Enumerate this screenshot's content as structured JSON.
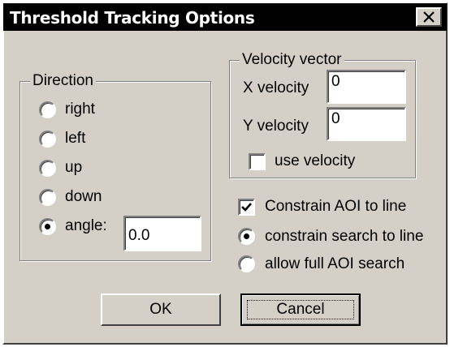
{
  "window": {
    "title": "Threshold Tracking Options",
    "close_glyph": "✕"
  },
  "direction": {
    "legend": "Direction",
    "options": [
      "right",
      "left",
      "up",
      "down",
      "angle:"
    ],
    "selected": "angle:",
    "angle_value": "0.0"
  },
  "velocity": {
    "legend": "Velocity vector",
    "x_label": "X velocity",
    "x_value": "0",
    "y_label": "Y velocity",
    "y_value": "0",
    "use_label": "use velocity",
    "use_checked": false
  },
  "constrain": {
    "checkbox_label": "Constrain AOI to line",
    "checkbox_checked": true,
    "options": [
      "constrain search to line",
      "allow full AOI search"
    ],
    "selected": "constrain search to line"
  },
  "buttons": {
    "ok": "OK",
    "cancel": "Cancel"
  },
  "colors": {
    "title_bg": "#000000",
    "face": "#d4d0c8"
  }
}
